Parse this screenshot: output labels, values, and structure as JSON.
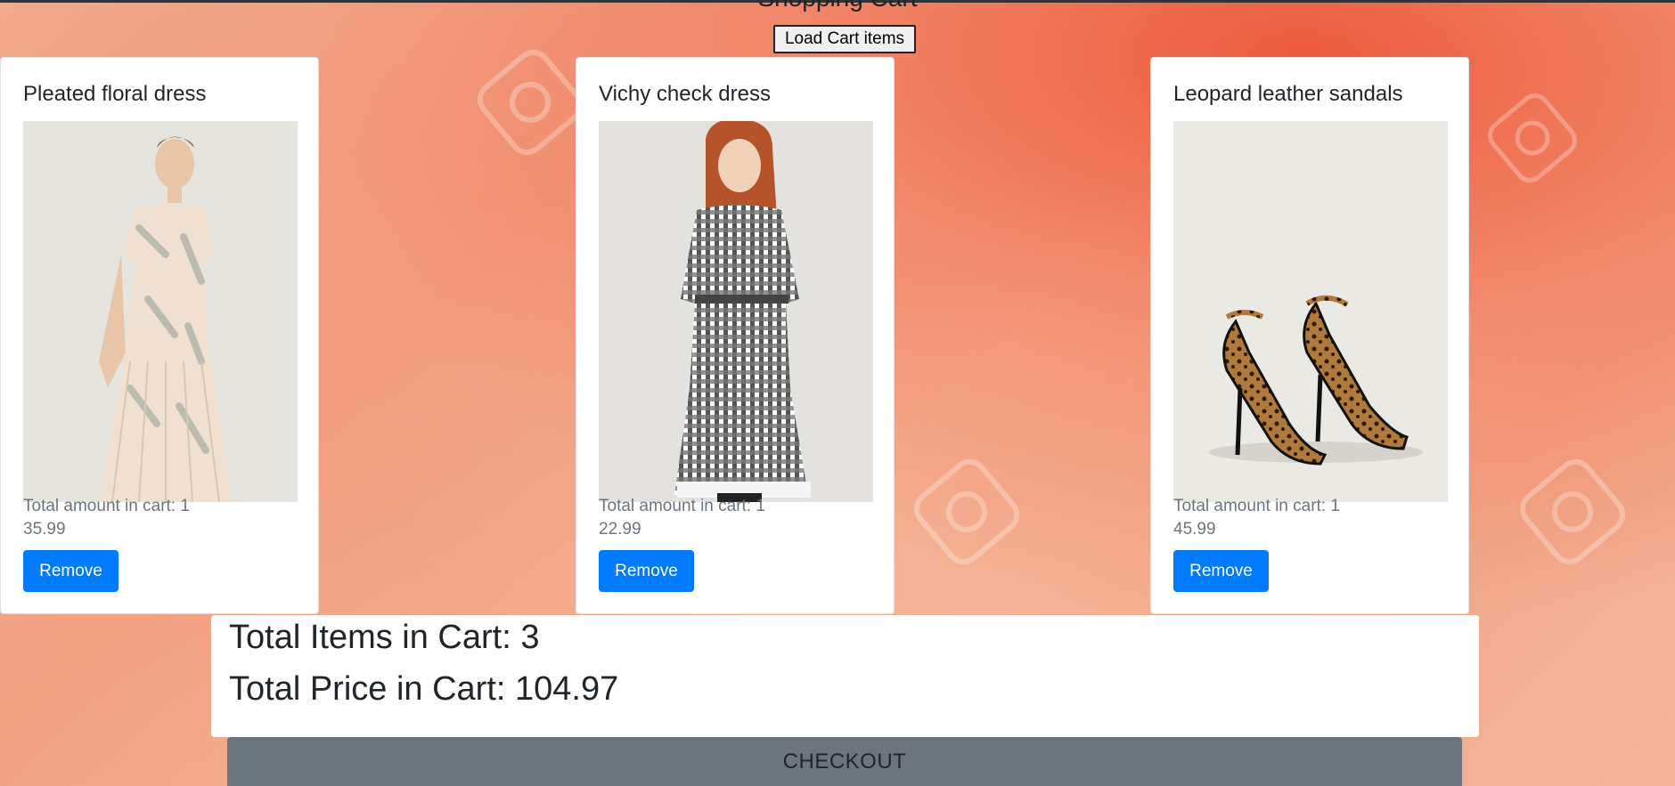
{
  "page": {
    "title": "Shopping Cart",
    "load_button": "Load Cart items"
  },
  "cart_items": [
    {
      "name": "Pleated floral dress",
      "image_icon": "dress-photo-icon",
      "quantity_text": "Total amount in cart: 1",
      "price": "35.99",
      "remove_label": "Remove"
    },
    {
      "name": "Vichy check dress",
      "image_icon": "dress-photo-icon",
      "quantity_text": "Total amount in cart: 1",
      "price": "22.99",
      "remove_label": "Remove"
    },
    {
      "name": "Leopard leather sandals",
      "image_icon": "sandals-photo-icon",
      "quantity_text": "Total amount in cart: 1",
      "price": "45.99",
      "remove_label": "Remove"
    }
  ],
  "summary": {
    "total_items": "Total Items in Cart: 3",
    "total_price": "Total Price in Cart: 104.97"
  },
  "checkout": {
    "label": "CHECKOUT"
  },
  "colors": {
    "primary": "#007bff",
    "secondary": "#6c757d",
    "background_accent": "#f3a083"
  }
}
